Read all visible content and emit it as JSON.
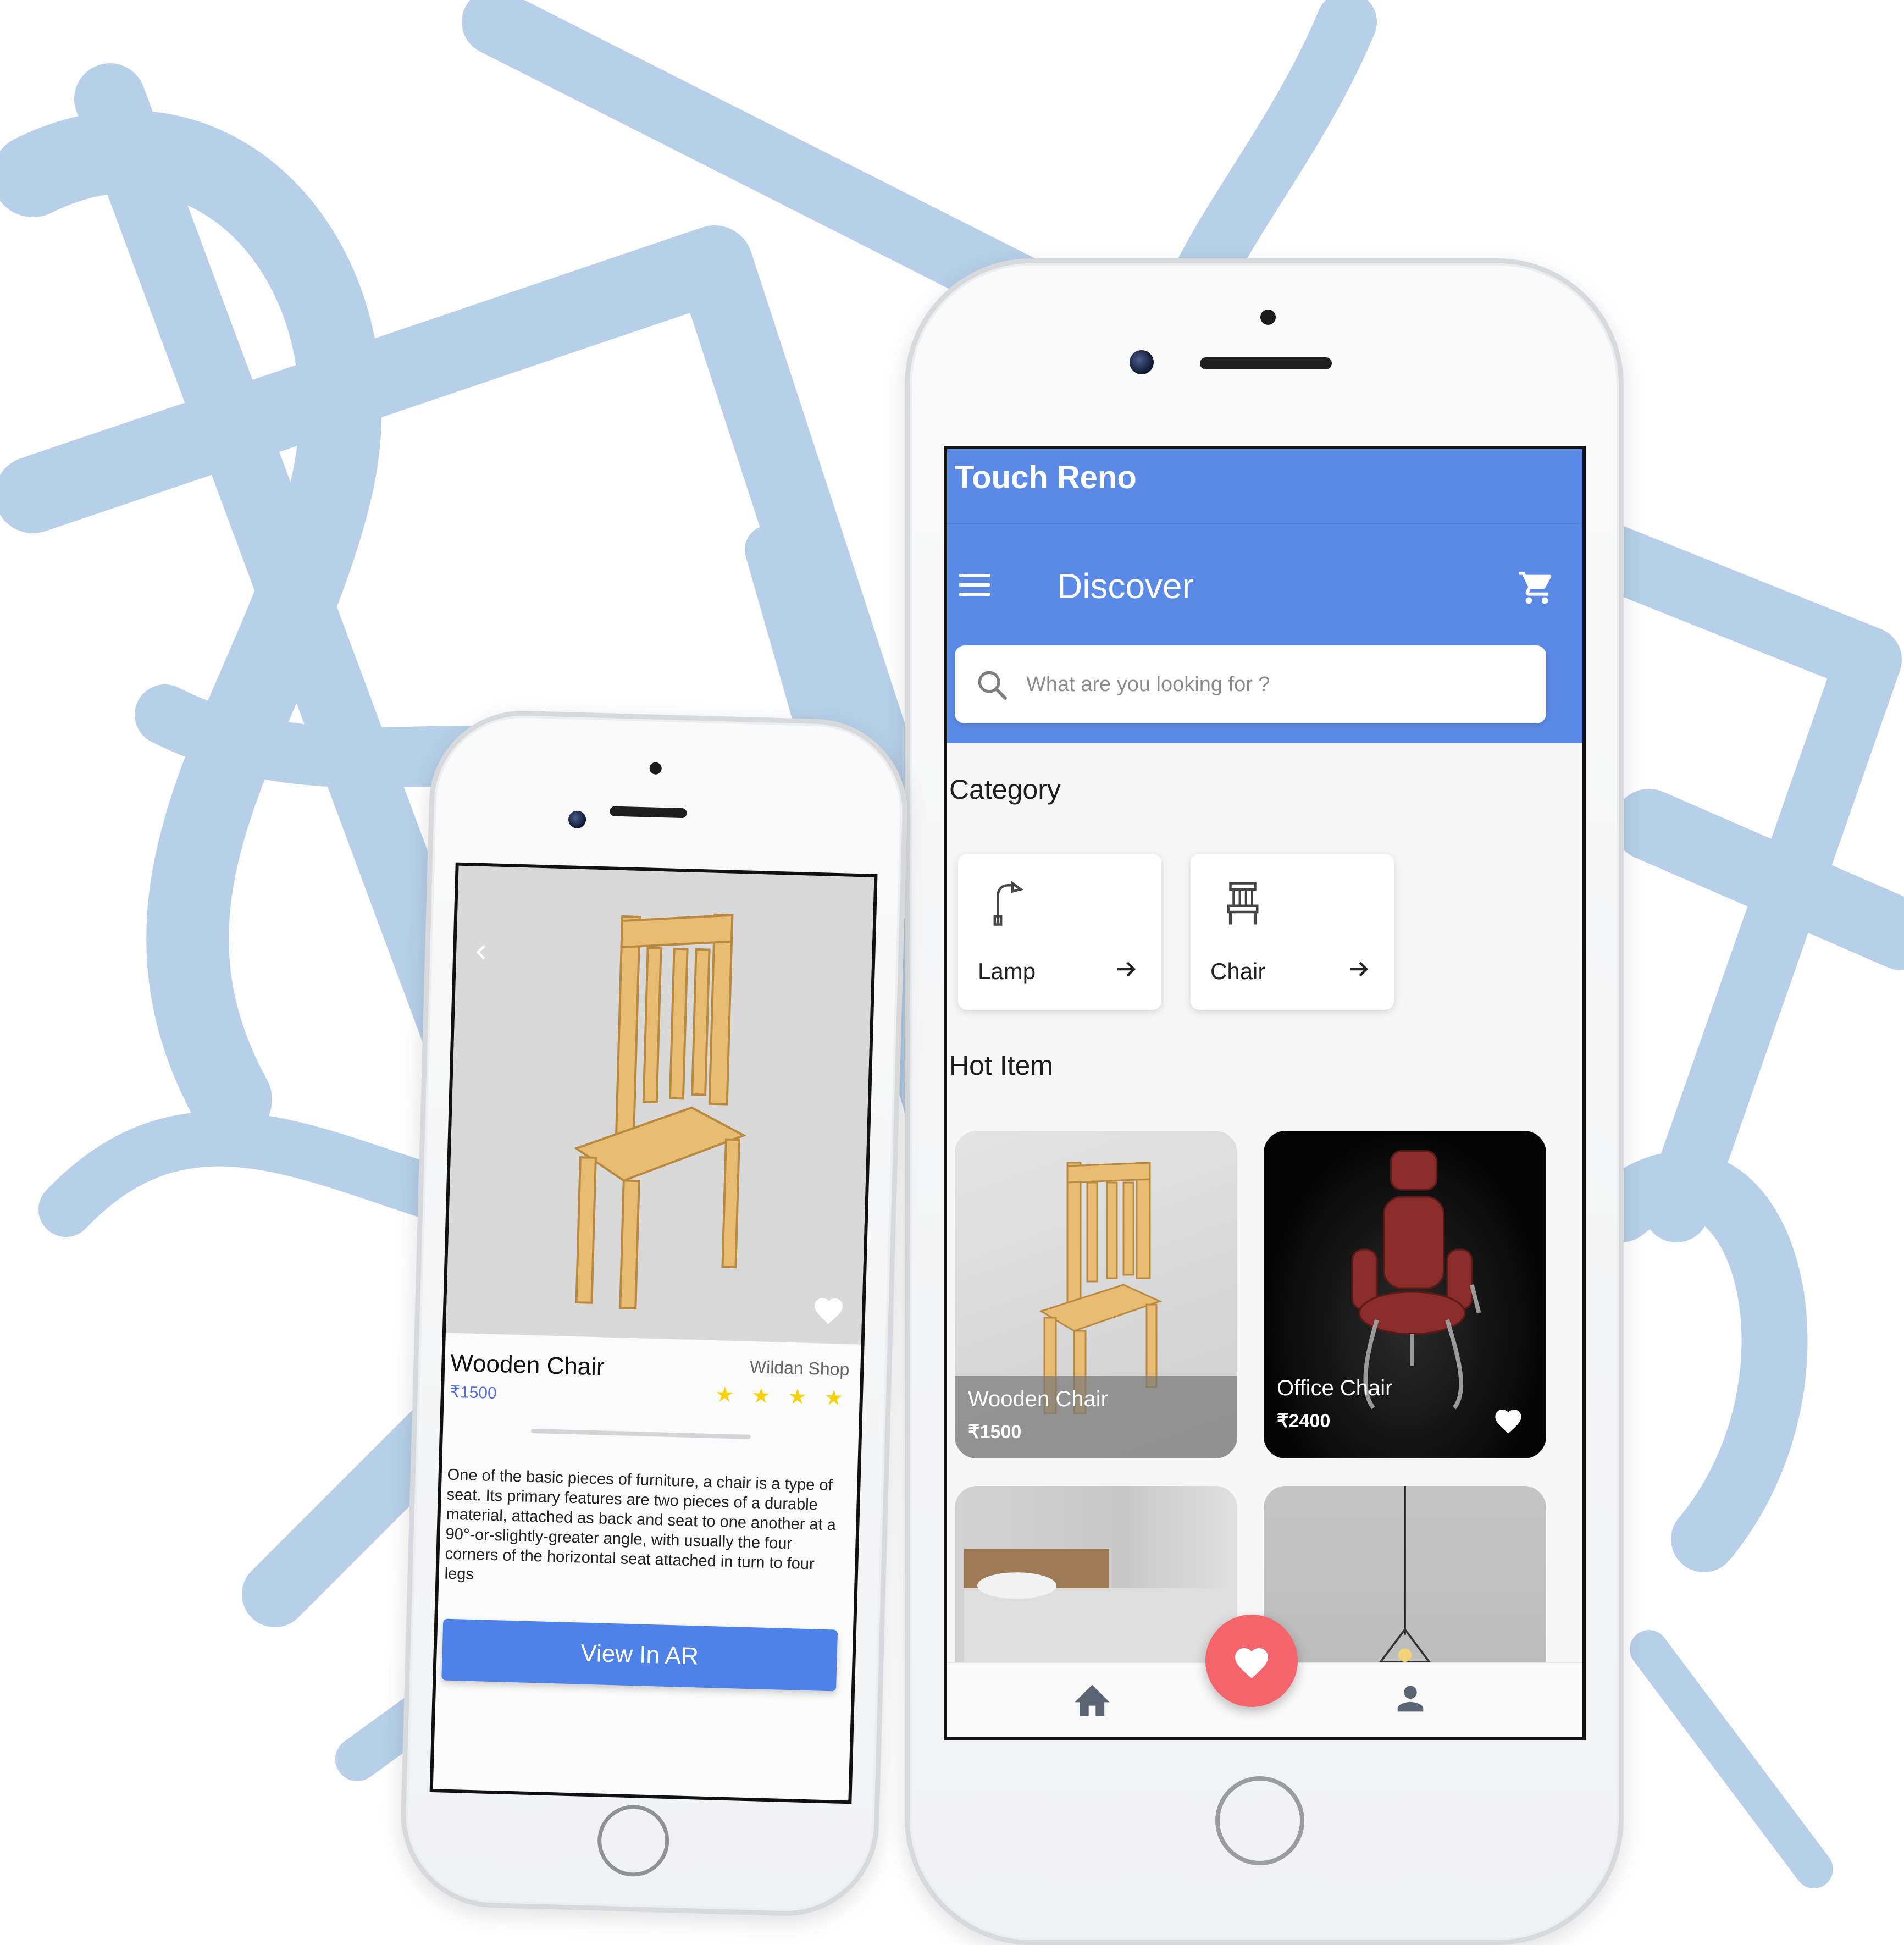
{
  "colors": {
    "primary": "#5b8ae6",
    "accent_fab": "#f4656b",
    "star": "#f5d20a",
    "price_link": "#5a6fe0",
    "ar_button": "#4f82e8",
    "background_scribble": "#b7cfe9"
  },
  "discover_screen": {
    "app_title": "Touch Reno",
    "header_title": "Discover",
    "menu_icon": "menu-icon",
    "cart_icon": "cart-icon",
    "search": {
      "icon": "search-icon",
      "placeholder": "What are you looking for ?"
    },
    "category": {
      "title": "Category",
      "items": [
        {
          "label": "Lamp",
          "icon": "lamp-icon"
        },
        {
          "label": "Chair",
          "icon": "chair-icon"
        }
      ]
    },
    "hot_item": {
      "title": "Hot Item",
      "items": [
        {
          "name": "Wooden Chair",
          "price": "₹1500"
        },
        {
          "name": "Office Chair",
          "price": "₹2400",
          "favorite": true
        }
      ]
    },
    "bottom_nav": {
      "left_icon": "home-icon",
      "center_icon": "heart-icon",
      "right_icon": "person-icon"
    }
  },
  "detail_screen": {
    "product_name": "Wooden Chair",
    "price": "₹1500",
    "shop": "Wildan Shop",
    "rating_stars": "★ ★ ★ ★",
    "rating": 4,
    "description": "One of the basic pieces of furniture, a chair is a type of seat. Its primary features are two pieces of a durable material, attached as back and seat to one another at a 90°-or-slightly-greater angle, with usually the four corners of the horizontal seat attached in turn to four legs",
    "ar_button": "View In AR"
  }
}
